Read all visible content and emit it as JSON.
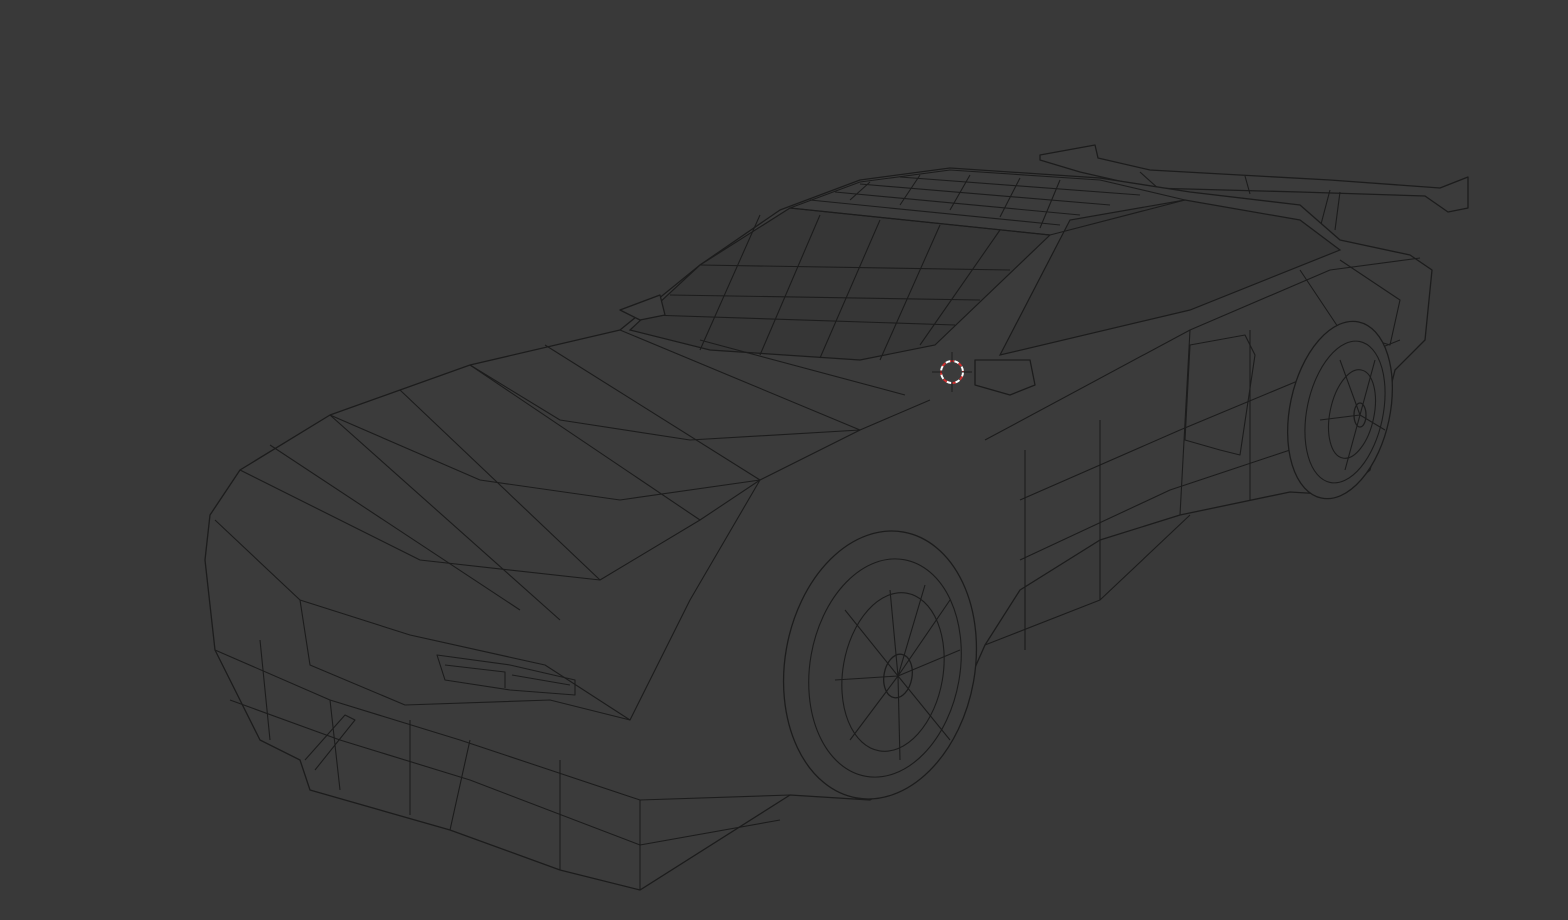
{
  "viewport": {
    "mode": "wireframe",
    "object": "car-mesh",
    "colors": {
      "background": "#393939",
      "wire": "#1c1c1c",
      "cursor_red": "#d03030",
      "cursor_white": "#ffffff"
    }
  },
  "icons": [
    "3d-cursor-icon"
  ]
}
